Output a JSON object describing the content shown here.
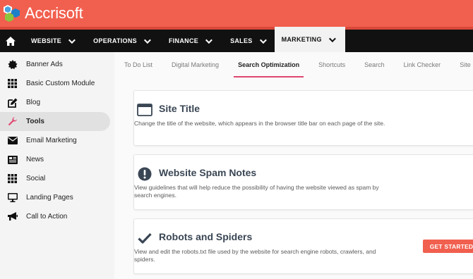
{
  "brand": {
    "name": "Accrisoft",
    "color": "#f15f4e"
  },
  "mainnav": {
    "home_icon": "home-icon",
    "items": [
      {
        "label": "WEBSITE"
      },
      {
        "label": "OPERATIONS"
      },
      {
        "label": "FINANCE"
      },
      {
        "label": "SALES"
      },
      {
        "label": "MARKETING",
        "active": true
      }
    ]
  },
  "sidebar": {
    "items": [
      {
        "label": "Banner Ads",
        "icon": "badge-icon"
      },
      {
        "label": "Basic Custom Module",
        "icon": "grid-icon"
      },
      {
        "label": "Blog",
        "icon": "edit-icon"
      },
      {
        "label": "Tools",
        "icon": "wrench-icon",
        "active": true
      },
      {
        "label": "Email Marketing",
        "icon": "envelope-icon"
      },
      {
        "label": "News",
        "icon": "newspaper-icon"
      },
      {
        "label": "Social",
        "icon": "grid-icon"
      },
      {
        "label": "Landing Pages",
        "icon": "monitor-icon"
      },
      {
        "label": "Call to Action",
        "icon": "megaphone-icon"
      }
    ]
  },
  "subtabs": [
    {
      "label": "To Do List"
    },
    {
      "label": "Digital Marketing"
    },
    {
      "label": "Search Optimization",
      "active": true
    },
    {
      "label": "Shortcuts"
    },
    {
      "label": "Search"
    },
    {
      "label": "Link Checker"
    },
    {
      "label": "Site Ma"
    }
  ],
  "cards": [
    {
      "title": "Site Title",
      "icon": "browser-window-icon",
      "description": "Change the title of the website, which appears in the browser title bar on each page of the site."
    },
    {
      "title": "Website Spam Notes",
      "icon": "exclamation-circle-icon",
      "description": "View guidelines that will help reduce the possibility of having the website viewed as spam by search engines."
    },
    {
      "title": "Robots and Spiders",
      "icon": "checkmark-icon",
      "description": "View and edit the robots.txt file used by the website for search engine robots, crawlers, and spiders.",
      "cta": "GET STARTED"
    }
  ],
  "colors": {
    "accent": "#f15f4e",
    "tab_underline": "#e0466f",
    "nav_bg": "#111111"
  }
}
